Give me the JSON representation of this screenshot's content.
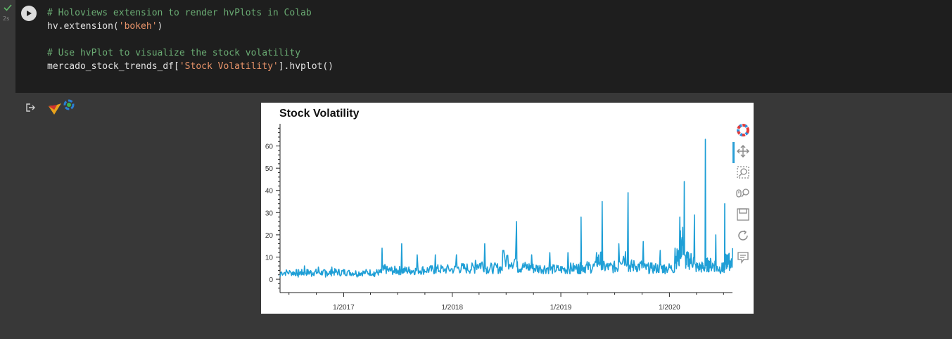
{
  "cell": {
    "exec_time": "2s",
    "code_lines": [
      {
        "parts": [
          {
            "t": "# Holoviews extension to render hvPlots in Colab",
            "c": "comment"
          }
        ]
      },
      {
        "parts": [
          {
            "t": "hv.extension(",
            "c": ""
          },
          {
            "t": "'bokeh'",
            "c": "str"
          },
          {
            "t": ")",
            "c": ""
          }
        ]
      },
      {
        "parts": [
          {
            "t": "",
            "c": ""
          }
        ]
      },
      {
        "parts": [
          {
            "t": "# Use hvPlot to visualize the stock volatility",
            "c": "comment"
          }
        ]
      },
      {
        "parts": [
          {
            "t": "mercado_stock_trends_df[",
            "c": ""
          },
          {
            "t": "'Stock Volatility'",
            "c": "str"
          },
          {
            "t": "].hvplot()",
            "c": ""
          }
        ]
      }
    ]
  },
  "plot": {
    "toolbar": [
      "bokeh-logo-icon",
      "pan-icon",
      "box-zoom-icon",
      "wheel-zoom-icon",
      "save-icon",
      "reset-icon",
      "hover-icon"
    ]
  },
  "chart_data": {
    "type": "line",
    "title": "Stock Volatility",
    "xlabel": "",
    "ylabel": "",
    "x_tick_labels": [
      "1/2017",
      "1/2018",
      "1/2019",
      "1/2020"
    ],
    "y_tick_labels": [
      "0",
      "10",
      "20",
      "30",
      "40",
      "50",
      "60"
    ],
    "xlim": [
      "2016-06-01",
      "2020-07-31"
    ],
    "ylim": [
      -6,
      70
    ],
    "grid": false,
    "color": "#1f9fd6",
    "series": [
      {
        "values_by_period": [
          {
            "x": "2016-06-01",
            "y": 1.2
          },
          {
            "x": "2016-07-08",
            "y": 2.8
          },
          {
            "x": "2016-08-01",
            "y": 1.0
          },
          {
            "x": "2016-08-22",
            "y": 6.0
          },
          {
            "x": "2016-09-15",
            "y": 1.3
          },
          {
            "x": "2016-10-08",
            "y": 5.5
          },
          {
            "x": "2016-11-01",
            "y": 1.0
          },
          {
            "x": "2016-11-22",
            "y": 5.5
          },
          {
            "x": "2016-12-20",
            "y": 1.5
          },
          {
            "x": "2017-01-15",
            "y": 3.5
          },
          {
            "x": "2017-02-15",
            "y": 1.0
          },
          {
            "x": "2017-03-15",
            "y": 2.8
          },
          {
            "x": "2017-04-15",
            "y": 1.2
          },
          {
            "x": "2017-05-10",
            "y": 14.0
          },
          {
            "x": "2017-05-25",
            "y": 4.0
          },
          {
            "x": "2017-06-20",
            "y": 3.0
          },
          {
            "x": "2017-07-15",
            "y": 16.0
          },
          {
            "x": "2017-08-10",
            "y": 3.0
          },
          {
            "x": "2017-09-05",
            "y": 11.0
          },
          {
            "x": "2017-10-05",
            "y": 3.5
          },
          {
            "x": "2017-11-05",
            "y": 11.0
          },
          {
            "x": "2017-12-05",
            "y": 4.0
          },
          {
            "x": "2018-01-15",
            "y": 11.0
          },
          {
            "x": "2018-02-15",
            "y": 5.0
          },
          {
            "x": "2018-03-20",
            "y": 8.5
          },
          {
            "x": "2018-04-20",
            "y": 16.0
          },
          {
            "x": "2018-05-20",
            "y": 5.0
          },
          {
            "x": "2018-06-20",
            "y": 13.0
          },
          {
            "x": "2018-08-05",
            "y": 26.0
          },
          {
            "x": "2018-08-25",
            "y": 6.0
          },
          {
            "x": "2018-09-25",
            "y": 11.0
          },
          {
            "x": "2018-10-25",
            "y": 5.0
          },
          {
            "x": "2018-11-25",
            "y": 12.0
          },
          {
            "x": "2018-12-25",
            "y": 4.0
          },
          {
            "x": "2019-01-25",
            "y": 12.0
          },
          {
            "x": "2019-02-25",
            "y": 5.0
          },
          {
            "x": "2019-03-10",
            "y": 28.0
          },
          {
            "x": "2019-04-01",
            "y": 6.0
          },
          {
            "x": "2019-05-01",
            "y": 12.0
          },
          {
            "x": "2019-05-20",
            "y": 35.0
          },
          {
            "x": "2019-06-15",
            "y": 6.0
          },
          {
            "x": "2019-07-15",
            "y": 16.0
          },
          {
            "x": "2019-08-15",
            "y": 39.0
          },
          {
            "x": "2019-09-05",
            "y": 7.0
          },
          {
            "x": "2019-10-05",
            "y": 17.0
          },
          {
            "x": "2019-11-01",
            "y": 5.0
          },
          {
            "x": "2019-12-01",
            "y": 13.0
          },
          {
            "x": "2019-12-20",
            "y": 5.0
          },
          {
            "x": "2020-01-20",
            "y": 14.0
          },
          {
            "x": "2020-02-05",
            "y": 28.0
          },
          {
            "x": "2020-02-20",
            "y": 44.0
          },
          {
            "x": "2020-03-05",
            "y": 12.0
          },
          {
            "x": "2020-03-25",
            "y": 29.0
          },
          {
            "x": "2020-04-15",
            "y": 6.0
          },
          {
            "x": "2020-05-01",
            "y": 63.0
          },
          {
            "x": "2020-05-15",
            "y": 8.0
          },
          {
            "x": "2020-06-05",
            "y": 20.0
          },
          {
            "x": "2020-06-25",
            "y": 5.0
          },
          {
            "x": "2020-07-05",
            "y": 34.0
          },
          {
            "x": "2020-07-15",
            "y": 11.0
          },
          {
            "x": "2020-07-31",
            "y": 14.0
          }
        ]
      }
    ]
  }
}
